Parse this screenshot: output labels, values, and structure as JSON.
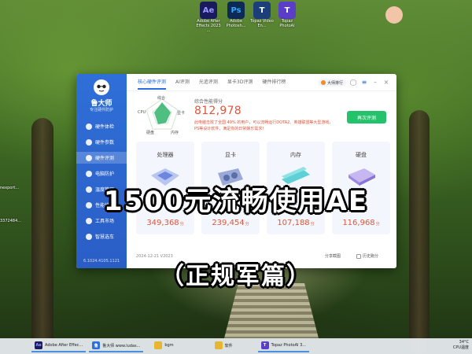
{
  "desktop": {
    "icons": [
      {
        "icon": "after-effects-icon",
        "glyph": "Ae",
        "color": "#1a1a5e",
        "label": "Adobe After Effects 2023 ..."
      },
      {
        "icon": "photoshop-icon",
        "glyph": "Ps",
        "color": "#0c2a55",
        "label": "Adobe Photosh..."
      },
      {
        "icon": "topaz-video-icon",
        "glyph": "T",
        "color": "#1c3f7a",
        "label": "Topaz Video En..."
      },
      {
        "icon": "topaz-photo-icon",
        "glyph": "T",
        "color": "#5a3ec8",
        "label": "Topaz PhotoAI"
      }
    ],
    "left_labels": [
      "nexport...",
      "3372484..."
    ]
  },
  "app": {
    "brand": "鲁大师",
    "brand_sub": "专注硬件防护",
    "sidebar": [
      {
        "label": "硬件体检",
        "icon": "health-check-icon"
      },
      {
        "label": "硬件参数",
        "icon": "hardware-info-icon"
      },
      {
        "label": "硬件评测",
        "icon": "benchmark-icon"
      },
      {
        "label": "电脑防护",
        "icon": "shield-icon"
      },
      {
        "label": "温度管理",
        "icon": "temperature-icon"
      },
      {
        "label": "性能优化",
        "icon": "optimize-icon"
      },
      {
        "label": "工具市场",
        "icon": "tools-icon"
      },
      {
        "label": "智慧选车",
        "icon": "car-icon"
      }
    ],
    "version": "6.1024.4105.1121",
    "tabs": [
      "核心硬件评测",
      "AI评测",
      "光追评测",
      "显卡3D评测",
      "硬件排行榜"
    ],
    "rank_button": "大师排行",
    "radar_labels": {
      "top": "综合",
      "left": "CPU",
      "right": "显卡",
      "bottom_left": "硬盘",
      "bottom_right": "内存"
    },
    "score_title": "综合性能得分",
    "score": "812,978",
    "description": "此电脑击败了全国 49% 的用户，可以流畅运行DOTA2、英雄联盟等大型游戏，PS等设计软件，满足你的日常娱乐需求！",
    "rescore_button": "再次评测",
    "cards": [
      {
        "title": "处理器",
        "score": "349,368",
        "unit": "分",
        "icon": "cpu-icon"
      },
      {
        "title": "显卡",
        "score": "239,454",
        "unit": "分",
        "icon": "gpu-icon"
      },
      {
        "title": "内存",
        "score": "107,188",
        "unit": "分",
        "icon": "memory-icon"
      },
      {
        "title": "硬盘",
        "score": "116,968",
        "unit": "分",
        "icon": "disk-icon"
      }
    ],
    "date": "2024-12-21 V2023",
    "share_link": "分享截图",
    "history_link": "历史跑分"
  },
  "overlay": {
    "line1": "1500元流畅使用AE",
    "line2": "（正规军篇）"
  },
  "taskbar": {
    "items": [
      {
        "label": "Adobe After Effec...",
        "glyph": "Ae",
        "color": "#1a1a5e",
        "running": true
      },
      {
        "label": "鲁大师 www.ludas...",
        "glyph": "鲁",
        "color": "#2f6fd8",
        "running": true
      },
      {
        "label": "bgm",
        "glyph": "",
        "color": "#e8b530",
        "running": false
      },
      {
        "label": "软件",
        "glyph": "",
        "color": "#e8b530",
        "running": false
      },
      {
        "label": "Topaz PhotoAI 3...",
        "glyph": "T",
        "color": "#5a3ec8",
        "running": true
      }
    ],
    "weather": "34°C",
    "weather_sub": "CPU温度"
  }
}
